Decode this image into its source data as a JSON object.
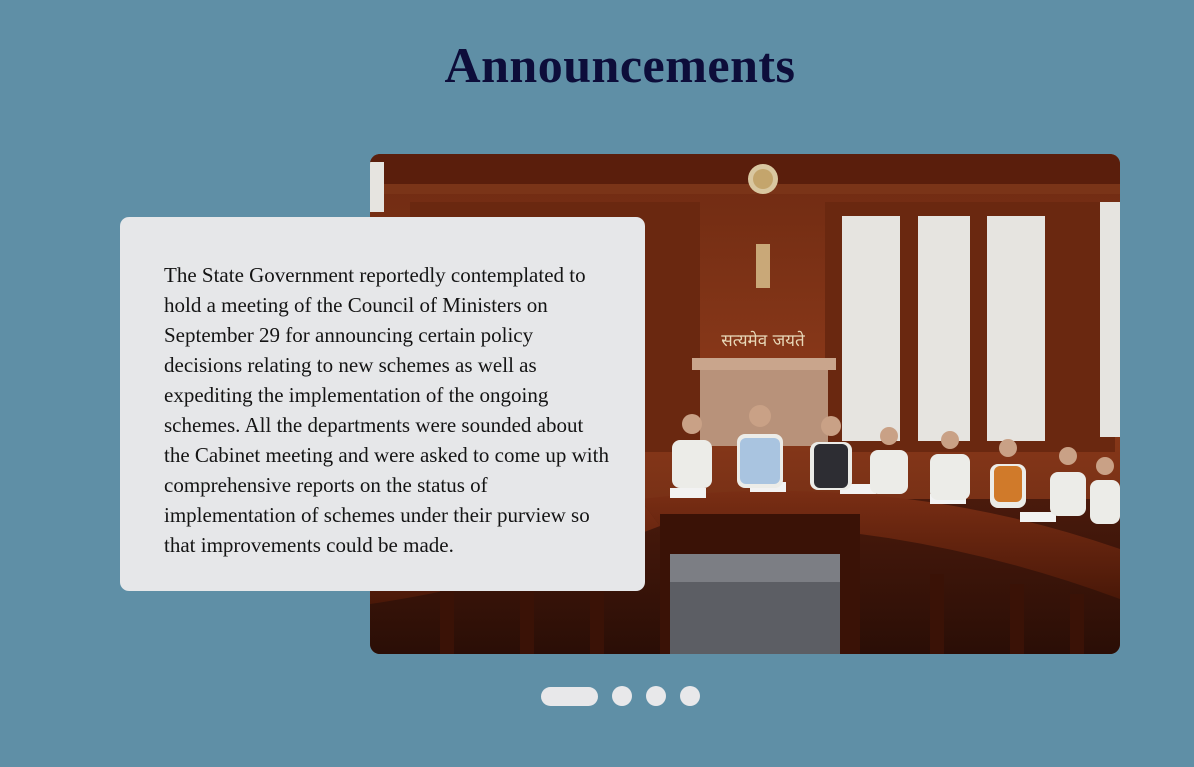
{
  "page": {
    "title": "Announcements"
  },
  "slider": {
    "active_index": 0,
    "slide_count": 4,
    "current_slide": {
      "text": "The State Government reportedly contemplated to hold a meeting of the Council of Ministers on September 29 for announcing certain policy decisions relating to new schemes as well as expediting the implementation of the ongoing schemes. All the departments were sounded about the Cabinet meeting and were asked to come up with comprehensive reports on the status of implementation of schemes under their purview so that improvements could be made.",
      "image_wall_inscription": "सत्यमेव जयते"
    }
  },
  "colors": {
    "background": "#5f8fa6",
    "title": "#0d0d3a",
    "card": "#e6e7e9",
    "dot": "#e8e8ea"
  }
}
